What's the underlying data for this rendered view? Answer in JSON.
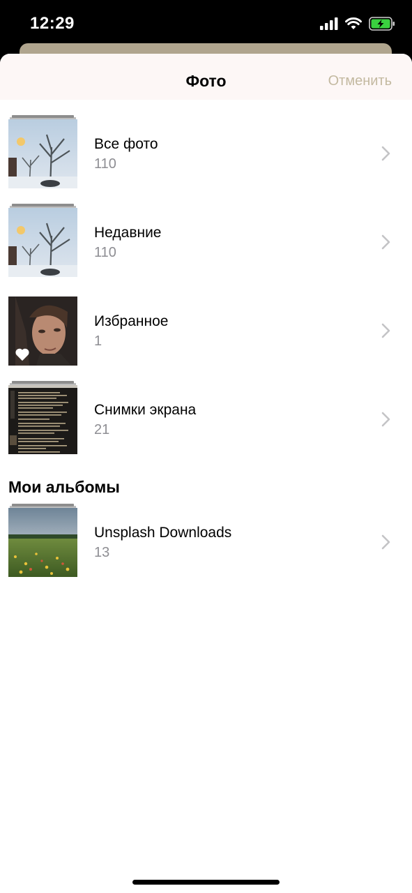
{
  "status_bar": {
    "time": "12:29"
  },
  "header": {
    "title": "Фото",
    "cancel_label": "Отменить"
  },
  "albums": [
    {
      "name": "Все фото",
      "count": "110",
      "thumb": "winter-tree-icon"
    },
    {
      "name": "Недавние",
      "count": "110",
      "thumb": "winter-tree-icon"
    },
    {
      "name": "Избранное",
      "count": "1",
      "thumb": "portrait-icon"
    },
    {
      "name": "Снимки экрана",
      "count": "21",
      "thumb": "screenshot-doc-icon"
    }
  ],
  "my_albums": {
    "title": "Мои альбомы",
    "items": [
      {
        "name": "Unsplash Downloads",
        "count": "13",
        "thumb": "meadow-icon"
      }
    ]
  },
  "colors": {
    "accent_cancel": "#c3b9a0",
    "count_gray": "#8e8e93",
    "header_bg": "#fdf7f6"
  }
}
